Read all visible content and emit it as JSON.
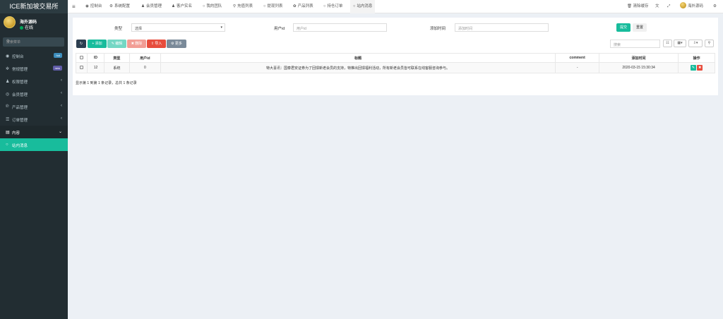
{
  "brand": {
    "title": "ICE新加坡交易所"
  },
  "user": {
    "name": "海外源码",
    "status": "在线"
  },
  "sidebar_search": {
    "placeholder": "搜索菜单"
  },
  "menu": [
    {
      "icon": "dashboard-icon",
      "glyph": "◉",
      "label": "控制台",
      "badge": "hot",
      "badge_color": "#3c8dbc"
    },
    {
      "icon": "settings-icon",
      "glyph": "✲",
      "label": "常规管理",
      "badge": "new",
      "badge_color": "#605ca8"
    },
    {
      "icon": "users-icon",
      "glyph": "♟",
      "label": "权限管理",
      "chev": "‹"
    },
    {
      "icon": "user-circle-icon",
      "glyph": "◎",
      "label": "会员管理",
      "chev": "‹"
    },
    {
      "icon": "product-icon",
      "glyph": "℗",
      "label": "产品管理",
      "chev": "‹"
    },
    {
      "icon": "list-icon",
      "glyph": "☰",
      "label": "订单管理",
      "chev": "‹"
    },
    {
      "icon": "content-icon",
      "glyph": "▤",
      "label": "内容",
      "chev": "⌄"
    },
    {
      "icon": "circle-icon",
      "glyph": "○",
      "label": "站内消息"
    }
  ],
  "tabs": [
    {
      "icon": "dashboard-icon",
      "glyph": "◉",
      "label": "控制台"
    },
    {
      "icon": "gear-icon",
      "glyph": "⚙",
      "label": "系统配置"
    },
    {
      "icon": "user-icon",
      "glyph": "♟",
      "label": "会员管理"
    },
    {
      "icon": "user-icon",
      "glyph": "♟",
      "label": "客户实名"
    },
    {
      "icon": "circle-icon",
      "glyph": "○",
      "label": "我的团队"
    },
    {
      "icon": "pin-icon",
      "glyph": "⚲",
      "label": "充值列表"
    },
    {
      "icon": "circle-icon",
      "glyph": "○",
      "label": "提现列表"
    },
    {
      "icon": "product-icon",
      "glyph": "✿",
      "label": "产品列表"
    },
    {
      "icon": "circle-icon",
      "glyph": "○",
      "label": "持仓订单"
    },
    {
      "icon": "circle-icon",
      "glyph": "○",
      "label": "站内消息"
    }
  ],
  "topright": {
    "clear_cache": "清除缓存",
    "user_name": "海外源码"
  },
  "filters": {
    "type_label": "类型",
    "type_value": "选择",
    "userid_label": "用户id",
    "userid_placeholder": "用户id",
    "time_label": "添加时间",
    "time_placeholder": "添加时间",
    "submit": "提交",
    "reset": "重置"
  },
  "toolbar": {
    "add": "添加",
    "edit": "编辑",
    "delete": "删除",
    "import": "导入",
    "more": "更多",
    "search_placeholder": "搜索"
  },
  "table": {
    "columns": [
      "ID",
      "类型",
      "用户id",
      "标题",
      "comment",
      "添加时间",
      "操作"
    ],
    "rows": [
      {
        "id": "12",
        "type": "系统",
        "userid": "0",
        "title": "特大喜讯：国泰君安证券为了回馈新老会员的支持，特推出回馈福利活动，所有新老会员皆可联系在线客服咨询参与。",
        "comment": "-",
        "time": "2020-03-15 15:30:34"
      }
    ]
  },
  "pager": {
    "text": "显示第 1 到第 1 条记录，总共 1 条记录"
  },
  "colors": {
    "accent": "#18bc9c",
    "sidebar": "#222d32",
    "danger": "#e74c3c",
    "dark": "#2c3e50"
  }
}
